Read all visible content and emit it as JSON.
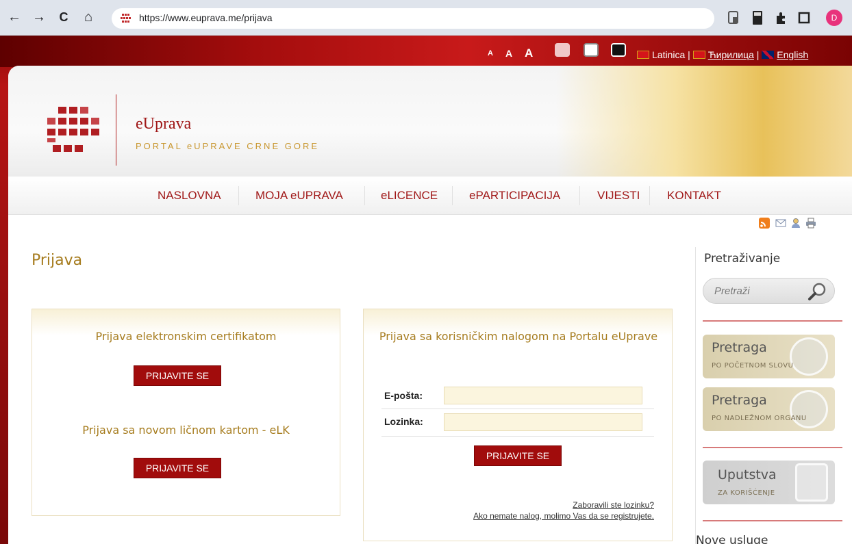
{
  "browser": {
    "back_glyph": "←",
    "forward_glyph": "→",
    "reload_glyph": "C",
    "home_glyph": "⌂",
    "url": "https://www.euprava.me/prijava",
    "profile_initial": "D"
  },
  "topbar": {
    "font_sizes": [
      "A",
      "A",
      "A"
    ],
    "lang_latinica": "Latinica",
    "lang_separator": "|",
    "lang_cyrillic": "Ћирилица",
    "lang_english": "English"
  },
  "header": {
    "title": "eUprava",
    "subtitle": "PORTAL eUPRAVE CRNE GORE"
  },
  "nav": {
    "items": [
      "NASLOVNA",
      "MOJA eUPRAVA",
      "eLICENCE",
      "ePARTICIPACIJA",
      "VIJESTI",
      "KONTAKT"
    ]
  },
  "main": {
    "title": "Prijava",
    "left_panel": {
      "cert_heading": "Prijava elektronskim certifikatom",
      "cert_button": "PRIJAVITE SE",
      "elk_heading": "Prijava sa novom ličnom kartom - eLK",
      "elk_button": "PRIJAVITE SE"
    },
    "right_panel": {
      "heading": "Prijava sa korisničkim nalogom na Portalu eUprave",
      "email_label": "E-pošta:",
      "email_value": "",
      "password_label": "Lozinka:",
      "password_value": "",
      "login_button": "PRIJAVITE SE",
      "forgot_link": "Zaboravili ste lozinku?",
      "register_link": "Ako nemate nalog, molimo Vas da se registrujete."
    }
  },
  "sidebar": {
    "search_title": "Pretraživanje",
    "search_placeholder": "Pretraži",
    "box1_title": "Pretraga",
    "box1_sub": "PO POČETNOM SLOVU",
    "box2_title": "Pretraga",
    "box2_sub": "PO NADLEŽNOM ORGANU",
    "box3_title": "Uputstva",
    "box3_sub": "ZA KORIŠĆENJE",
    "bottom_title": "Nove usluge"
  },
  "colors": {
    "brand_red": "#a10c0c",
    "gold": "#a67c1e"
  }
}
